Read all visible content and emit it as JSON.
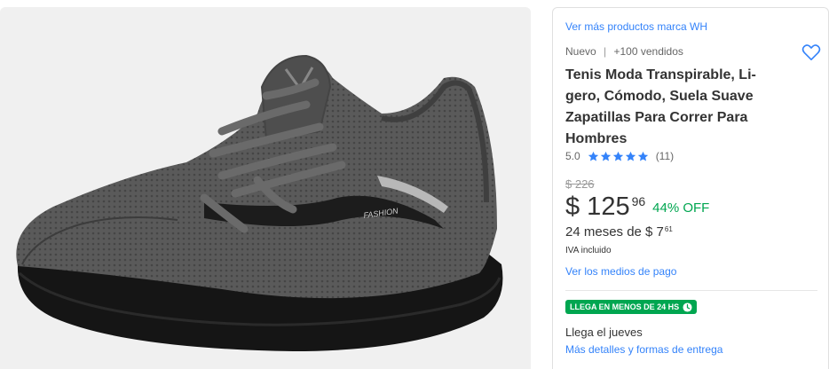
{
  "product": {
    "image_alt": "gray knit running shoe with black sole",
    "shoe_print_text": "FASHION"
  },
  "brand_link": "Ver más productos marca WH",
  "condition": {
    "status": "Nuevo",
    "separator": "|",
    "sold": "+100 vendidos"
  },
  "title_lines": [
    "Tenis Moda Transpirable, Li-",
    "gero, Cómodo, Suela Suave",
    "Zapatillas Para Correr Para",
    "Hombres"
  ],
  "rating": {
    "score": "5.0",
    "stars": 5,
    "count": "(11)",
    "star_color": "#3483fa"
  },
  "price": {
    "original": "$ 226",
    "current": "$ 125",
    "cents": "96",
    "discount": "44% OFF"
  },
  "installments": {
    "text": "24 meses de $ 7",
    "cents": "61"
  },
  "tax_note": "IVA incluido",
  "payment_link": "Ver los medios de pago",
  "shipping": {
    "badge": "LLEGA EN MENOS DE 24 HS",
    "arrival": "Llega el jueves",
    "details_link": "Más detalles y formas de entrega",
    "badge_color": "#00a650"
  },
  "colors": {
    "link": "#3483fa",
    "discount": "#00a650"
  },
  "icons": {
    "favorite": "heart-icon",
    "rating": "star-icon",
    "badge": "clock-icon"
  }
}
